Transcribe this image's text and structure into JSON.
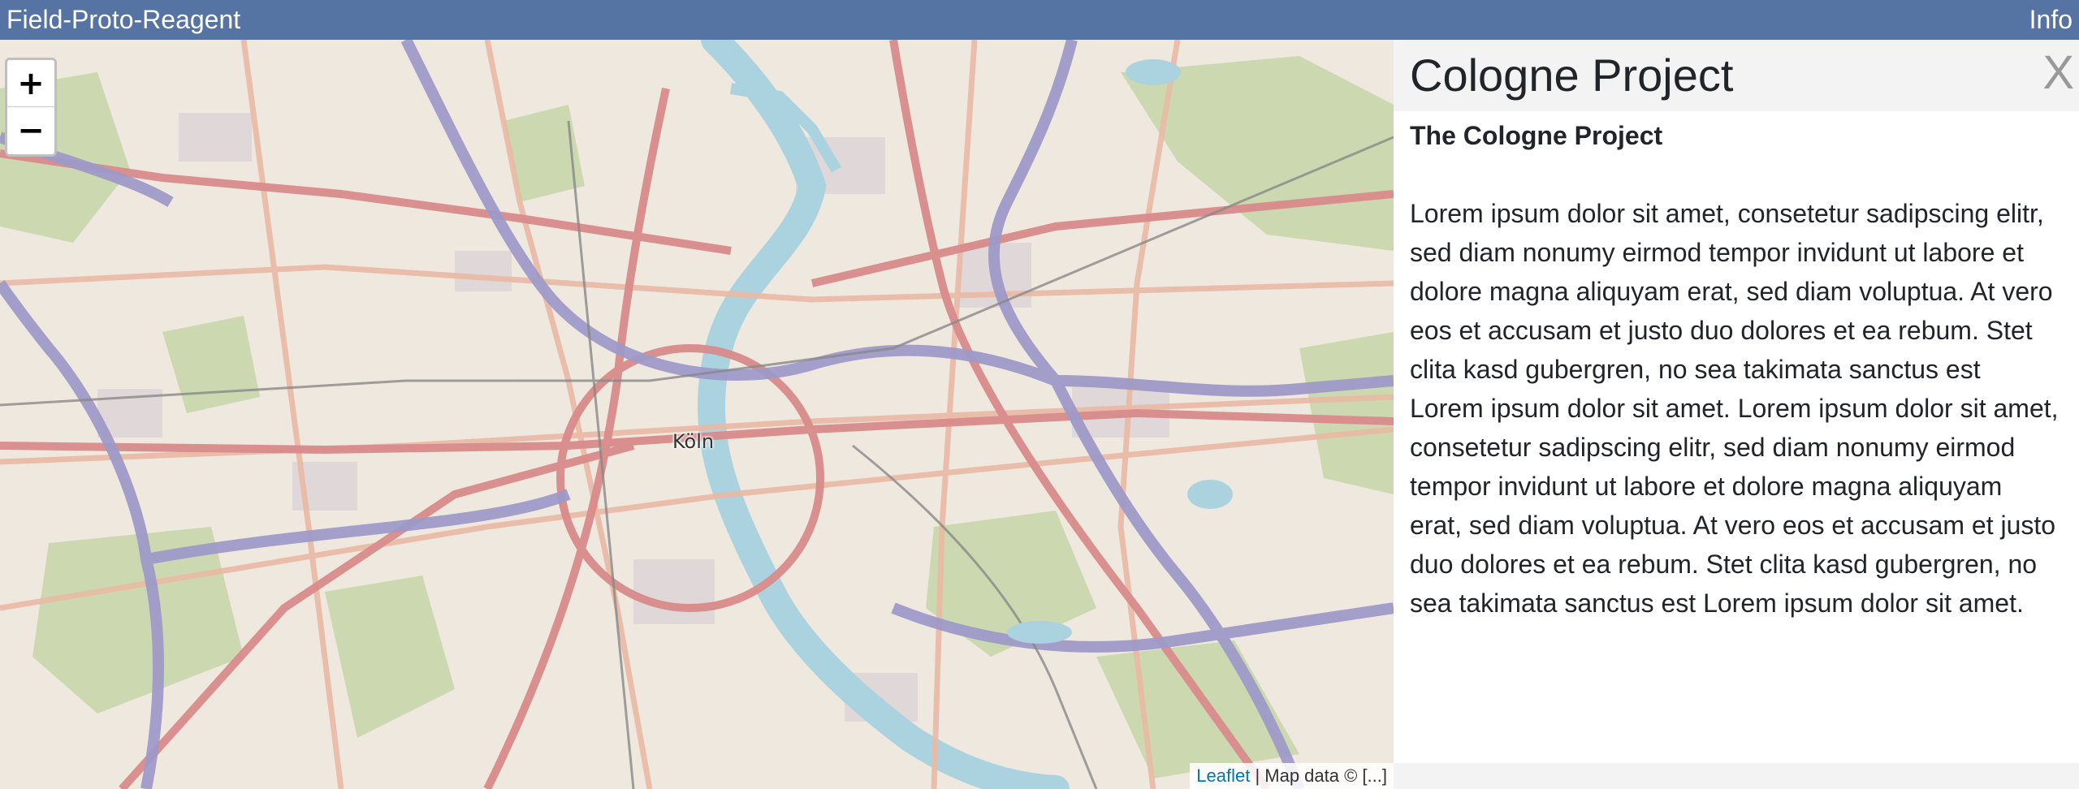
{
  "navbar": {
    "brand": "Field-Proto-Reagent",
    "info_label": "Info",
    "color": "#5573a3"
  },
  "map": {
    "zoom_in_label": "+",
    "zoom_out_label": "−",
    "city_label": "Köln",
    "attribution_link": "Leaflet",
    "attribution_text": " | Map data © [...]",
    "colors": {
      "background": "#eee8df",
      "river": "#aad3df",
      "motorway": "#9e9ac8",
      "primary_road": "#d98b8b",
      "secondary_road": "#e9b9a4",
      "park": "#c8d7ab",
      "residential": "#e0dfdf"
    }
  },
  "panel": {
    "title": "Cologne Project",
    "close_label": "X",
    "subtitle": "The Cologne Project",
    "body": "Lorem ipsum dolor sit amet, consetetur sadipscing elitr, sed diam nonumy eirmod tempor invidunt ut labore et dolore magna aliquyam erat, sed diam voluptua. At vero eos et accusam et justo duo dolores et ea rebum. Stet clita kasd gubergren, no sea takimata sanctus est Lorem ipsum dolor sit amet. Lorem ipsum dolor sit amet, consetetur sadipscing elitr, sed diam nonumy eirmod tempor invidunt ut labore et dolore magna aliquyam erat, sed diam voluptua. At vero eos et accusam et justo duo dolores et ea rebum. Stet clita kasd gubergren, no sea takimata sanctus est Lorem ipsum dolor sit amet."
  }
}
